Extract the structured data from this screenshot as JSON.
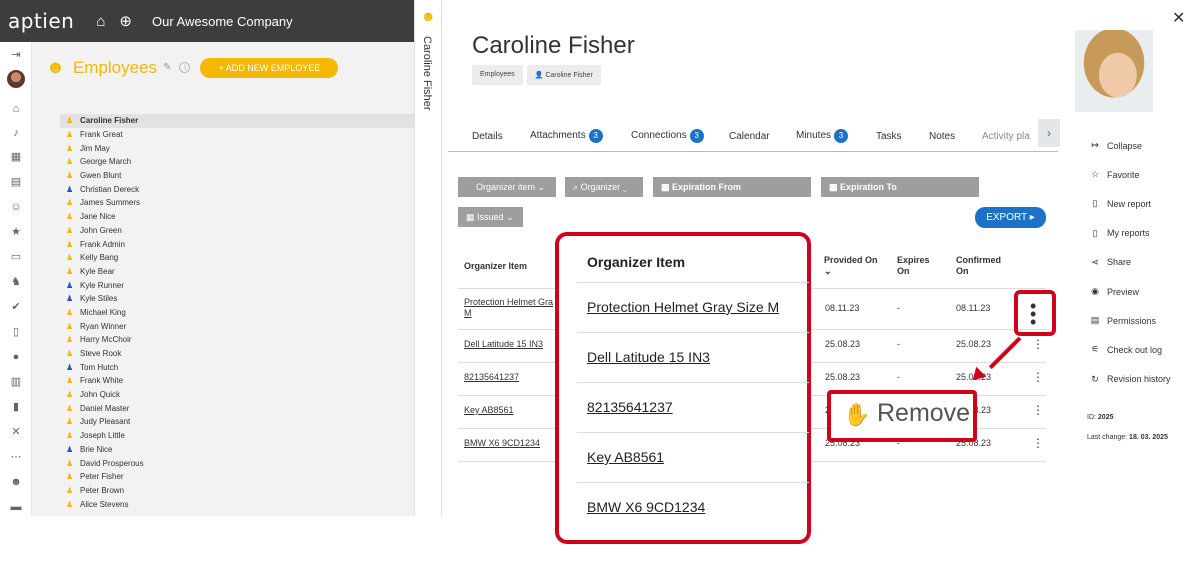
{
  "topbar": {
    "logo": "aptien",
    "company": "Our Awesome Company"
  },
  "employees": {
    "title": "Employees",
    "add_label": "+ ADD NEW EMPLOYEE",
    "list": [
      {
        "name": "Caroline Fisher",
        "color": "yellow",
        "active": true
      },
      {
        "name": "Frank Great",
        "color": "yellow"
      },
      {
        "name": "Jim May",
        "color": "yellow"
      },
      {
        "name": "George March",
        "color": "yellow"
      },
      {
        "name": "Gwen Blunt",
        "color": "yellow"
      },
      {
        "name": "Christian Dereck",
        "color": "blue"
      },
      {
        "name": "James Summers",
        "color": "yellow"
      },
      {
        "name": "Jane Nice",
        "color": "yellow"
      },
      {
        "name": "John Green",
        "color": "yellow"
      },
      {
        "name": "Frank Admin",
        "color": "yellow"
      },
      {
        "name": "Kelly Bang",
        "color": "yellow"
      },
      {
        "name": "Kyle Bear",
        "color": "yellow"
      },
      {
        "name": "Kyle Runner",
        "color": "blue"
      },
      {
        "name": "Kyle Stiles",
        "color": "blue"
      },
      {
        "name": "Michael King",
        "color": "yellow"
      },
      {
        "name": "Ryan Winner",
        "color": "yellow"
      },
      {
        "name": "Harry McChoir",
        "color": "yellow"
      },
      {
        "name": "Steve Rook",
        "color": "yellow"
      },
      {
        "name": "Tom Hutch",
        "color": "blue"
      },
      {
        "name": "Frank White",
        "color": "yellow"
      },
      {
        "name": "John Quick",
        "color": "yellow"
      },
      {
        "name": "Daniel Master",
        "color": "yellow"
      },
      {
        "name": "Judy Pleasant",
        "color": "yellow"
      },
      {
        "name": "Joseph Little",
        "color": "yellow"
      },
      {
        "name": "Brie Nice",
        "color": "blue"
      },
      {
        "name": "David Prosperous",
        "color": "yellow"
      },
      {
        "name": "Peter Fisher",
        "color": "yellow"
      },
      {
        "name": "Peter Brown",
        "color": "yellow"
      },
      {
        "name": "Alice Stevens",
        "color": "yellow"
      }
    ]
  },
  "sidetab": {
    "label": "Caroline Fisher"
  },
  "detail": {
    "name": "Caroline Fisher",
    "crumbs": [
      "Employees",
      "Caroline Fisher"
    ],
    "tabs": [
      "Details",
      "Attachments",
      "Connections",
      "Calendar",
      "Minutes",
      "Tasks",
      "Notes",
      "Activity pla"
    ],
    "tab_counts": {
      "attachments": "3",
      "connections": "3",
      "minutes": "3"
    },
    "filters": {
      "organizer_item": "Organizer item",
      "organizer": "Organizer",
      "expiration_from": "Expiration From",
      "expiration_to": "Expiration To",
      "issued": "Issued"
    },
    "export_label": "EXPORT",
    "table": {
      "headers": {
        "item": "Organizer Item",
        "provided": "Provided On",
        "expires": "Expires",
        "expires2": "On",
        "confirmed": "Confirmed",
        "confirmed2": "On"
      },
      "rows": [
        {
          "item_line1": "Protection Helmet Gra",
          "item_line2": "M",
          "provided": "08.11.23",
          "expires": "-",
          "confirmed": "08.11.23"
        },
        {
          "item_line1": "Dell Latitude 15 IN3",
          "item_line2": "",
          "provided": "25.08.23",
          "expires": "-",
          "confirmed": "25.08.23"
        },
        {
          "item_line1": "82135641237",
          "item_line2": "",
          "provided": "25.08.23",
          "expires": "-",
          "confirmed": "25.08.23"
        },
        {
          "item_line1": "Key AB8561",
          "item_line2": "",
          "provided": "25.08.23",
          "expires": "-",
          "confirmed": "25.08.23"
        },
        {
          "item_line1": "BMW X6 9CD1234",
          "item_line2": "",
          "provided": "25.08.23",
          "expires": "-",
          "confirmed": "25.08.23"
        }
      ]
    }
  },
  "zoom_popup": {
    "header": "Organizer Item",
    "items": [
      "Protection Helmet Gray Size M",
      "Dell Latitude 15 IN3",
      "82135641237",
      "Key AB8561",
      "BMW X6 9CD1234"
    ]
  },
  "remove_callout": {
    "label": "Remove"
  },
  "sidepanel": {
    "actions": [
      "Collapse",
      "Favorite",
      "New report",
      "My reports",
      "Share",
      "Preview",
      "Permissions",
      "Check out log",
      "Revision history"
    ],
    "id_label": "ID:",
    "id_value": "2025",
    "last_change_label": "Last change:",
    "last_change_value": "18. 03. 2025"
  },
  "colors": {
    "accent_yellow": "#f5b700",
    "accent_blue": "#1a73c8",
    "highlight_red": "#d0021b"
  }
}
